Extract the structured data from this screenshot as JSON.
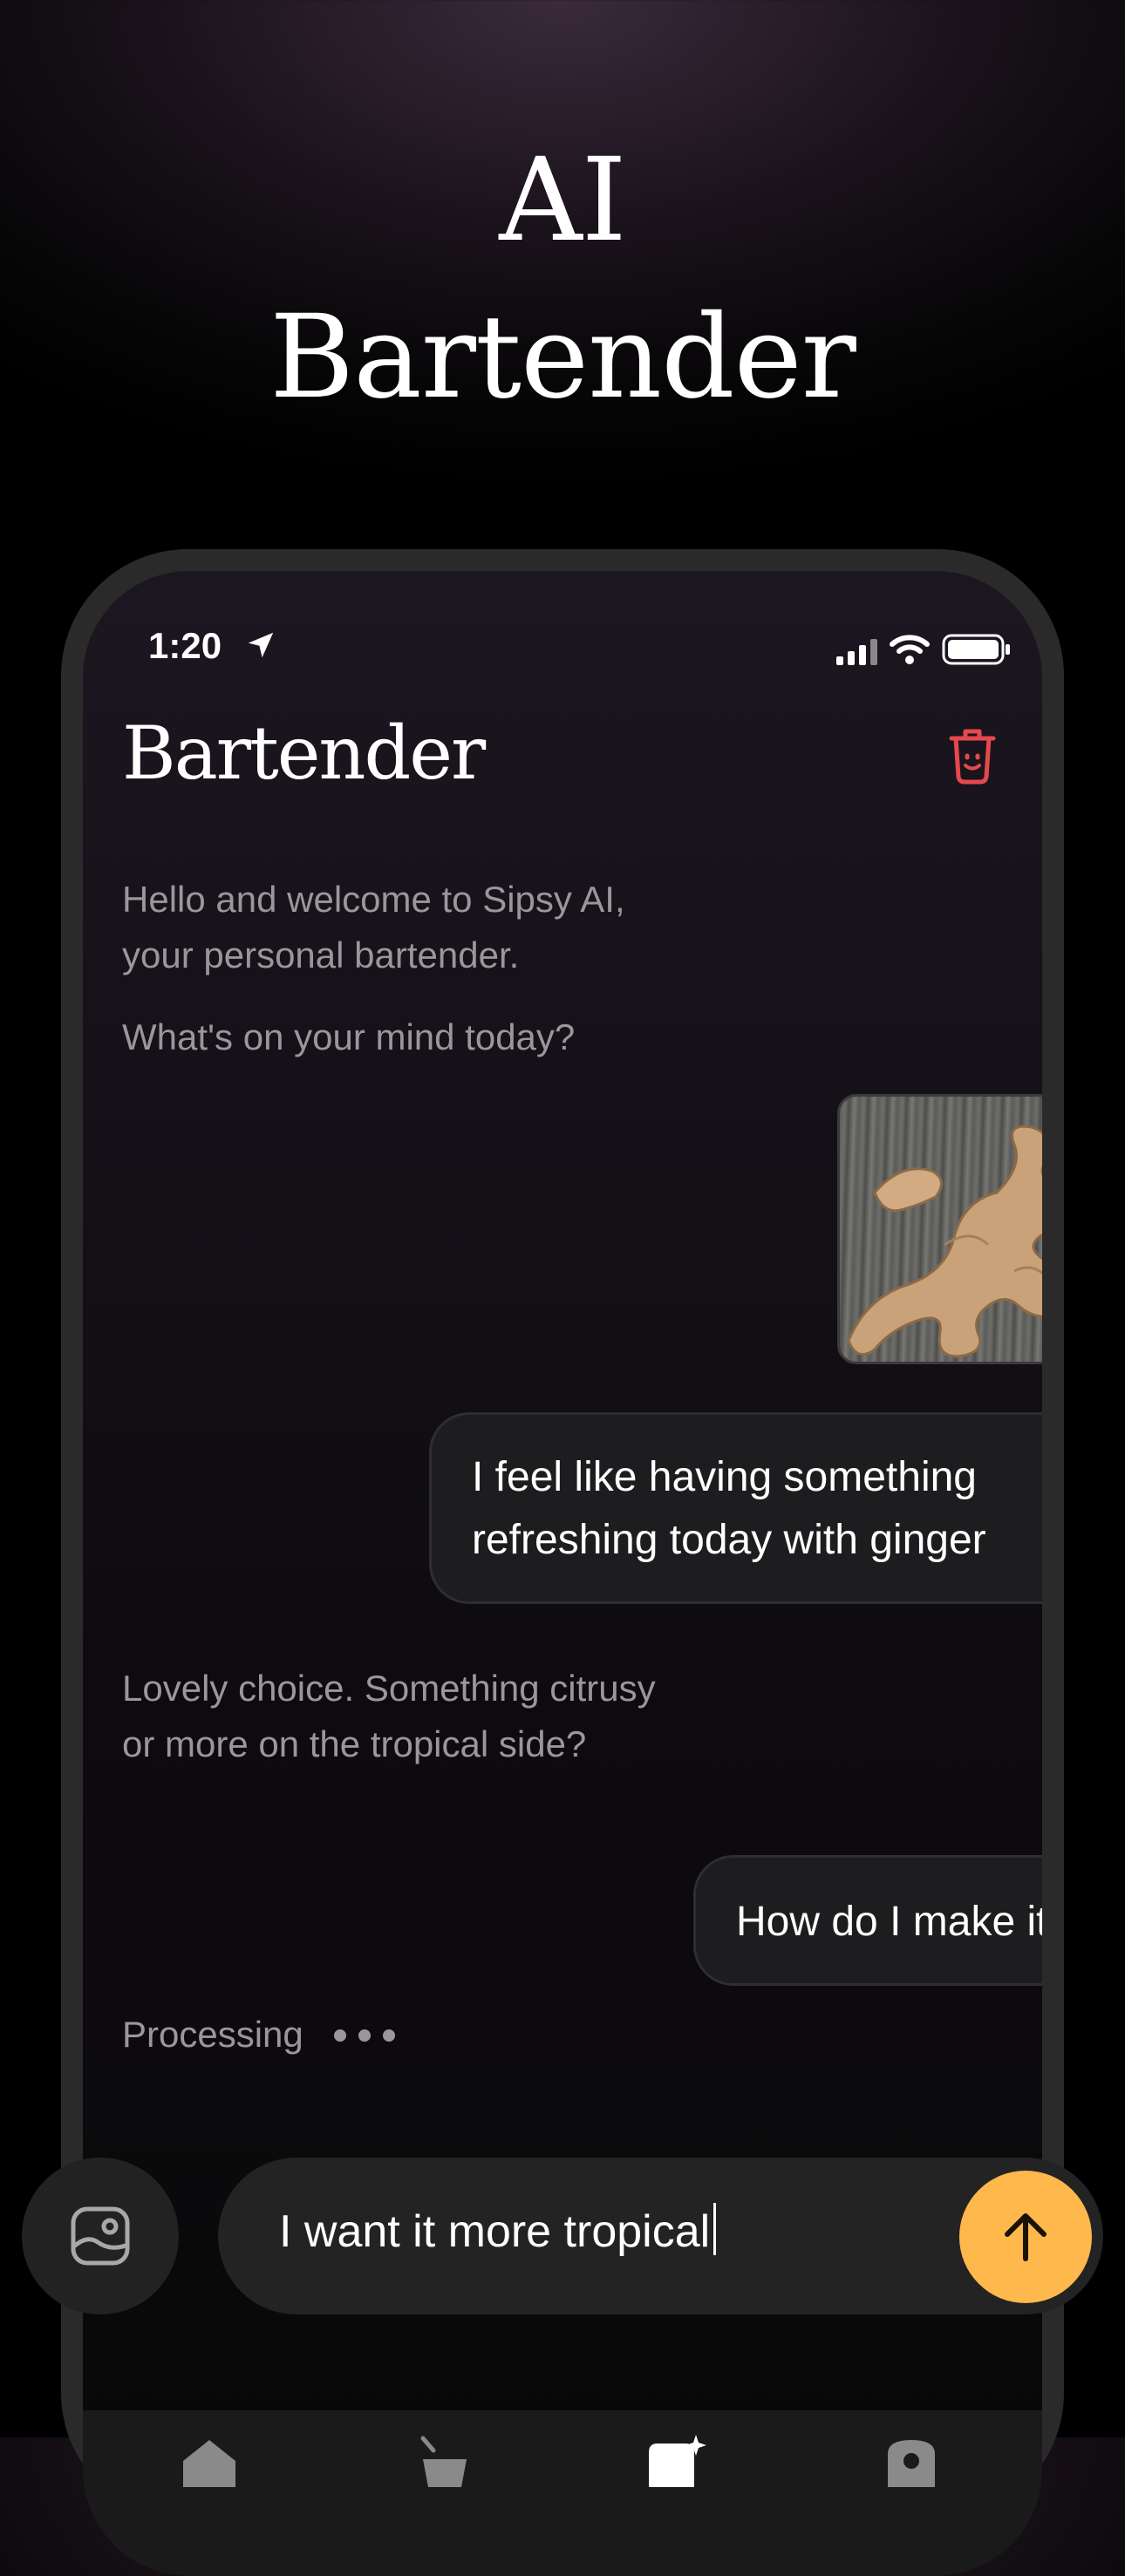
{
  "headline": {
    "line1": "AI",
    "line2": "Bartender"
  },
  "status_bar": {
    "time": "1:20"
  },
  "header": {
    "title": "Bartender"
  },
  "icons": {
    "location": "location-arrow-icon",
    "signal": "cellular-signal-icon",
    "wifi": "wifi-icon",
    "battery": "battery-icon",
    "delete": "trash-icon",
    "gallery": "image-gallery-icon",
    "send": "arrow-up-icon"
  },
  "messages": {
    "welcome": [
      "Hello and welcome to Sipsy AI,",
      "your personal bartender."
    ],
    "prompt": "What's on your mind today?",
    "user_image": "ginger root photo",
    "user_text_1": [
      "I feel like having something",
      "refreshing today with ginger"
    ],
    "bot_reply": [
      "Lovely choice. Something citrusy",
      "or more on the tropical side?"
    ],
    "user_text_2": "How do I make it?",
    "processing": "Processing"
  },
  "composer": {
    "value": "I want it more tropical"
  },
  "colors": {
    "accent": "#ffb84b",
    "trash": "#e5484d",
    "bot_text": "#9b969a",
    "bubble_bg": "#1d1d1f"
  },
  "tab_bar": {
    "tabs": [
      {
        "icon": "home-icon"
      },
      {
        "icon": "cocktail-glass-icon"
      },
      {
        "icon": "ai-chat-sparkle-icon",
        "active": true
      },
      {
        "icon": "profile-icon"
      }
    ]
  }
}
